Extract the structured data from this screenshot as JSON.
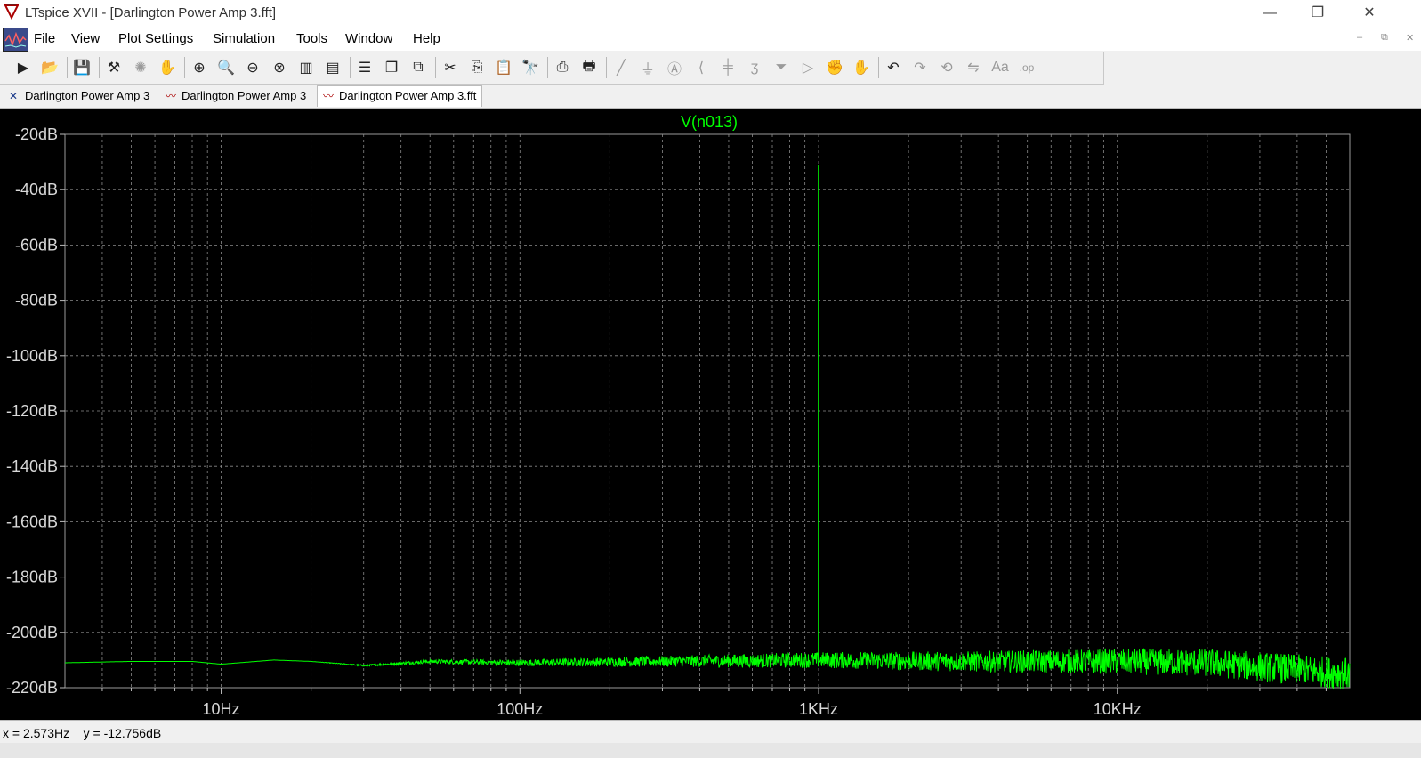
{
  "window": {
    "title": "LTspice XVII - [Darlington Power Amp 3.fft]",
    "controls": {
      "minimize": "—",
      "restore": "❐",
      "close": "✕"
    }
  },
  "menu": {
    "items": [
      "File",
      "View",
      "Plot Settings",
      "Simulation",
      "Tools",
      "Window",
      "Help"
    ],
    "mdi_controls": [
      "–",
      "⧉",
      "✕"
    ]
  },
  "toolbar": {
    "buttons": [
      {
        "name": "run-icon",
        "glyph": "▶",
        "enabled": true
      },
      {
        "name": "open-icon",
        "glyph": "📂",
        "enabled": true
      },
      {
        "name": "save-icon",
        "glyph": "💾",
        "enabled": true
      },
      {
        "name": "control-panel-icon",
        "glyph": "⚒",
        "enabled": true
      },
      {
        "name": "halt-icon",
        "glyph": "✺",
        "enabled": false
      },
      {
        "name": "pan-icon",
        "glyph": "✋",
        "enabled": false
      },
      {
        "name": "zoom-in-icon",
        "glyph": "⊕",
        "enabled": true
      },
      {
        "name": "zoom-area-icon",
        "glyph": "🔍",
        "enabled": true
      },
      {
        "name": "zoom-out-icon",
        "glyph": "⊖",
        "enabled": true
      },
      {
        "name": "zoom-fit-icon",
        "glyph": "⊗",
        "enabled": true
      },
      {
        "name": "autorange-icon",
        "glyph": "▥",
        "enabled": true
      },
      {
        "name": "autorange-y-icon",
        "glyph": "▤",
        "enabled": true
      },
      {
        "name": "tile-horizontal-icon",
        "glyph": "☰",
        "enabled": true
      },
      {
        "name": "cascade-icon",
        "glyph": "❐",
        "enabled": true
      },
      {
        "name": "tile-vertical-icon",
        "glyph": "⧉",
        "enabled": true
      },
      {
        "name": "cut-icon",
        "glyph": "✂",
        "enabled": true
      },
      {
        "name": "copy-icon",
        "glyph": "⎘",
        "enabled": true
      },
      {
        "name": "paste-icon",
        "glyph": "📋",
        "enabled": true
      },
      {
        "name": "find-icon",
        "glyph": "🔭",
        "enabled": true
      },
      {
        "name": "print-preview-icon",
        "glyph": "⎙",
        "enabled": true
      },
      {
        "name": "print-icon",
        "glyph": "🖶",
        "enabled": true
      },
      {
        "name": "draw-wire-icon",
        "glyph": "╱",
        "enabled": false
      },
      {
        "name": "ground-icon",
        "glyph": "⏚",
        "enabled": false
      },
      {
        "name": "label-net-icon",
        "glyph": "Ⓐ",
        "enabled": false
      },
      {
        "name": "resistor-icon",
        "glyph": "⟨",
        "enabled": false
      },
      {
        "name": "capacitor-icon",
        "glyph": "╪",
        "enabled": false
      },
      {
        "name": "inductor-icon",
        "glyph": "ʒ",
        "enabled": false
      },
      {
        "name": "diode-icon",
        "glyph": "⏷",
        "enabled": false
      },
      {
        "name": "component-icon",
        "glyph": "▷",
        "enabled": false
      },
      {
        "name": "move-icon",
        "glyph": "✊",
        "enabled": false
      },
      {
        "name": "drag-icon",
        "glyph": "✋",
        "enabled": false
      },
      {
        "name": "undo-icon",
        "glyph": "↶",
        "enabled": true
      },
      {
        "name": "redo-icon",
        "glyph": "↷",
        "enabled": false
      },
      {
        "name": "rotate-icon",
        "glyph": "⟲",
        "enabled": false
      },
      {
        "name": "mirror-icon",
        "glyph": "⇋",
        "enabled": false
      },
      {
        "name": "text-icon",
        "glyph": "Aa",
        "enabled": false
      },
      {
        "name": "spice-directive-icon",
        "glyph": ".op",
        "enabled": false
      }
    ]
  },
  "tabs": [
    {
      "label": "Darlington Power Amp 3",
      "icon": "schematic-icon",
      "active": false
    },
    {
      "label": "Darlington Power Amp 3",
      "icon": "waveform-icon",
      "active": false
    },
    {
      "label": "Darlington Power Amp 3.fft",
      "icon": "waveform-icon",
      "active": true
    }
  ],
  "status": {
    "text": "x = 2.573Hz    y = -12.756dB"
  },
  "colors": {
    "trace": "#00ff00",
    "grid": "#8a8a8a",
    "axis_text": "#d8d8d8",
    "background": "#000000"
  },
  "chart_data": {
    "type": "line",
    "title": "V(n013)",
    "x_scale": "log",
    "xlim": [
      3,
      60000
    ],
    "ylim": [
      -220,
      -20
    ],
    "x_ticks": [
      {
        "value": 10,
        "label": "10Hz"
      },
      {
        "value": 100,
        "label": "100Hz"
      },
      {
        "value": 1000,
        "label": "1KHz"
      },
      {
        "value": 10000,
        "label": "10KHz"
      }
    ],
    "y_ticks": [
      {
        "value": -20,
        "label": "-20dB"
      },
      {
        "value": -40,
        "label": "-40dB"
      },
      {
        "value": -60,
        "label": "-60dB"
      },
      {
        "value": -80,
        "label": "-80dB"
      },
      {
        "value": -100,
        "label": "-100dB"
      },
      {
        "value": -120,
        "label": "-120dB"
      },
      {
        "value": -140,
        "label": "-140dB"
      },
      {
        "value": -160,
        "label": "-160dB"
      },
      {
        "value": -180,
        "label": "-180dB"
      },
      {
        "value": -200,
        "label": "-200dB"
      },
      {
        "value": -220,
        "label": "-220dB"
      }
    ],
    "grid": true,
    "series": [
      {
        "name": "V(n013)",
        "color": "#00ff00",
        "peak": {
          "x": 1000,
          "y": -31
        },
        "noise_floor": [
          {
            "x": 3,
            "y": -211
          },
          {
            "x": 5,
            "y": -210.5
          },
          {
            "x": 8,
            "y": -210.5
          },
          {
            "x": 10,
            "y": -211.5
          },
          {
            "x": 15,
            "y": -210
          },
          {
            "x": 20,
            "y": -210.5
          },
          {
            "x": 30,
            "y": -212
          },
          {
            "x": 50,
            "y": -210.5
          },
          {
            "x": 100,
            "y": -211
          },
          {
            "x": 300,
            "y": -210.5
          },
          {
            "x": 1000,
            "y": -210
          },
          {
            "x": 3000,
            "y": -210.5
          },
          {
            "x": 10000,
            "y": -210.5
          },
          {
            "x": 20000,
            "y": -211
          },
          {
            "x": 40000,
            "y": -213.5
          },
          {
            "x": 60000,
            "y": -215
          }
        ]
      }
    ]
  }
}
